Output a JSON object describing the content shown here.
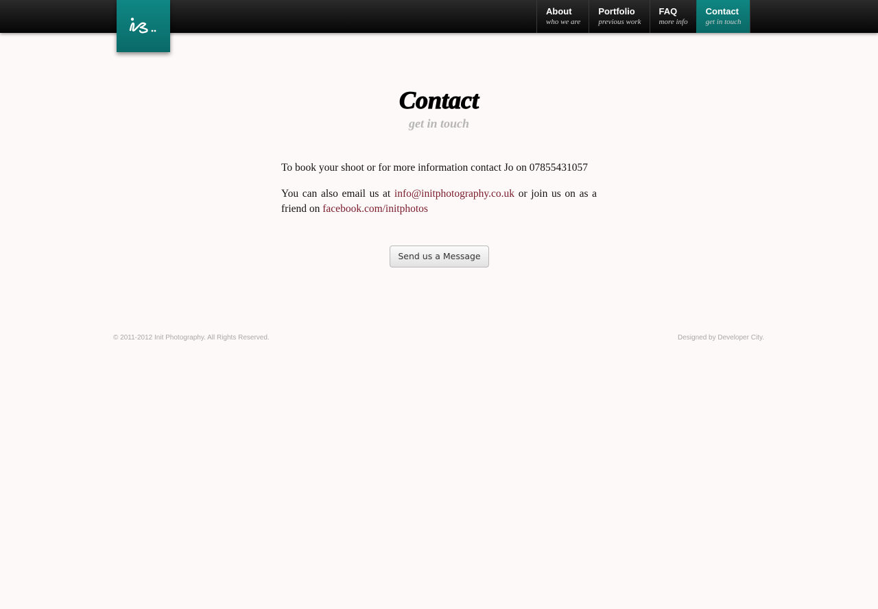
{
  "nav": [
    {
      "title": "About",
      "sub": "who we are"
    },
    {
      "title": "Portfolio",
      "sub": "previous work"
    },
    {
      "title": "FAQ",
      "sub": "more info"
    },
    {
      "title": "Contact",
      "sub": "get in touch"
    }
  ],
  "active_nav": "Contact",
  "heading": {
    "title": "Contact",
    "subtitle": "get in touch"
  },
  "content": {
    "line1": "To book your shoot or for more information contact Jo on 07855431057",
    "p2_prefix": "You can also email us at",
    "email": "info@initphotography.co.uk",
    "p2_middle": "or join us on as a friend on",
    "facebook": "facebook.com/initphotos"
  },
  "button_label": "Send us a Message",
  "footer": {
    "copyright": "© 2011-2012 Init Photography. All Rights Reserved.",
    "designer": "Designed by Developer City."
  },
  "colors": {
    "accent": "#0a6f6c",
    "link": "#7a1a2a",
    "background": "#fdf9f8"
  },
  "icons": {
    "logo": "is-script-logo"
  }
}
